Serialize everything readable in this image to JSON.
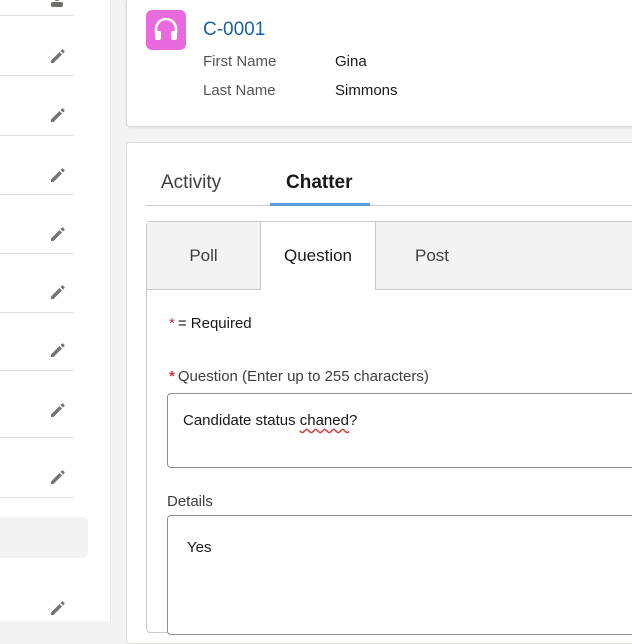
{
  "record": {
    "icon": "headset-icon",
    "title": "C-0001",
    "fields": [
      {
        "label": "First Name",
        "value": "Gina"
      },
      {
        "label": "Last Name",
        "value": "Simmons"
      }
    ]
  },
  "tabs": [
    {
      "label": "Activity",
      "active": false
    },
    {
      "label": "Chatter",
      "active": true
    }
  ],
  "publisher": {
    "tabs": [
      {
        "label": "Poll",
        "active": false
      },
      {
        "label": "Question",
        "active": true
      },
      {
        "label": "Post",
        "active": false
      }
    ],
    "required_star": "*",
    "required_note": "= Required",
    "question_label": "Question (Enter up to 255 characters)",
    "question_value_before": "Candidate status ",
    "question_value_misspelled": "chaned",
    "question_value_after": "?",
    "details_label": "Details",
    "details_value": "Yes"
  },
  "colors": {
    "accent": "#1b5fa6",
    "record_icon_bg": "#e86ade",
    "tab_underline": "#5b9bd5",
    "required": "#c23934"
  }
}
